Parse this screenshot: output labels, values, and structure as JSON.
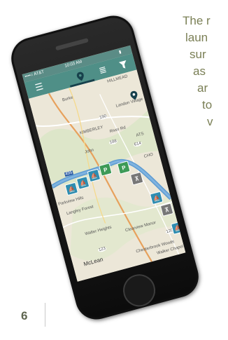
{
  "copy": {
    "lines": [
      "The r",
      "laun",
      "sur",
      "as",
      "ar",
      "to",
      "v"
    ]
  },
  "page_number": "6",
  "phone": {
    "status_bar": {
      "carrier": "••••○ AT&T",
      "time": "10:03 AM"
    },
    "toolbar": {
      "menu_icon": "hamburger-icon",
      "location_icon": "map-pin-icon",
      "list_icon": "list-icon",
      "filter_icon": "filter-icon"
    },
    "map": {
      "place_labels": [
        "HILLMEAD",
        "Landon Village",
        "KIMBERLEY",
        "River Rd",
        "Parkview Hills",
        "Langley Forest",
        "Walter Heights",
        "Clearview Manor",
        "McLean",
        "Chesterbrook Woods",
        "Walker Chapel",
        "Burke",
        "John",
        "CHO",
        "ATS"
      ],
      "road_shields": [
        "190",
        "188",
        "614",
        "495",
        "123",
        "120"
      ],
      "marker_types": [
        "parking-icon",
        "picnic-icon",
        "boat-launch-icon"
      ]
    }
  }
}
